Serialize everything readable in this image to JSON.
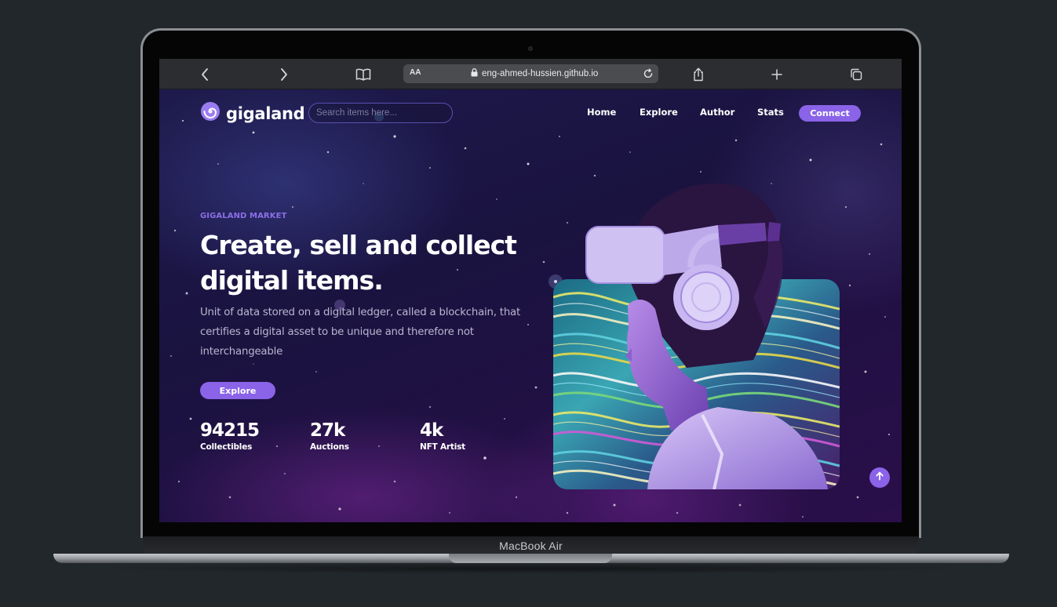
{
  "device": {
    "label": "MacBook Air"
  },
  "browser": {
    "address_prefix": "AA",
    "url": "eng-ahmed-hussien.github.io"
  },
  "site": {
    "logo_text": "gigaland",
    "search_placeholder": "Search items here...",
    "nav": [
      "Home",
      "Explore",
      "Author",
      "Stats"
    ],
    "connect_label": "Connect",
    "eyebrow": "GIGALAND MARKET",
    "headline_line1": "Create, sell and collect",
    "headline_line2": "digital items.",
    "description": "Unit of data stored on a digital ledger, called a blockchain, that certifies a digital asset to be unique and therefore not interchangeable",
    "explore_label": "Explore",
    "stats": [
      {
        "value": "94215",
        "label": "Collectibles"
      },
      {
        "value": "27k",
        "label": "Auctions"
      },
      {
        "value": "4k",
        "label": "NFT Artist"
      }
    ],
    "accent_color": "#8a63e8"
  }
}
